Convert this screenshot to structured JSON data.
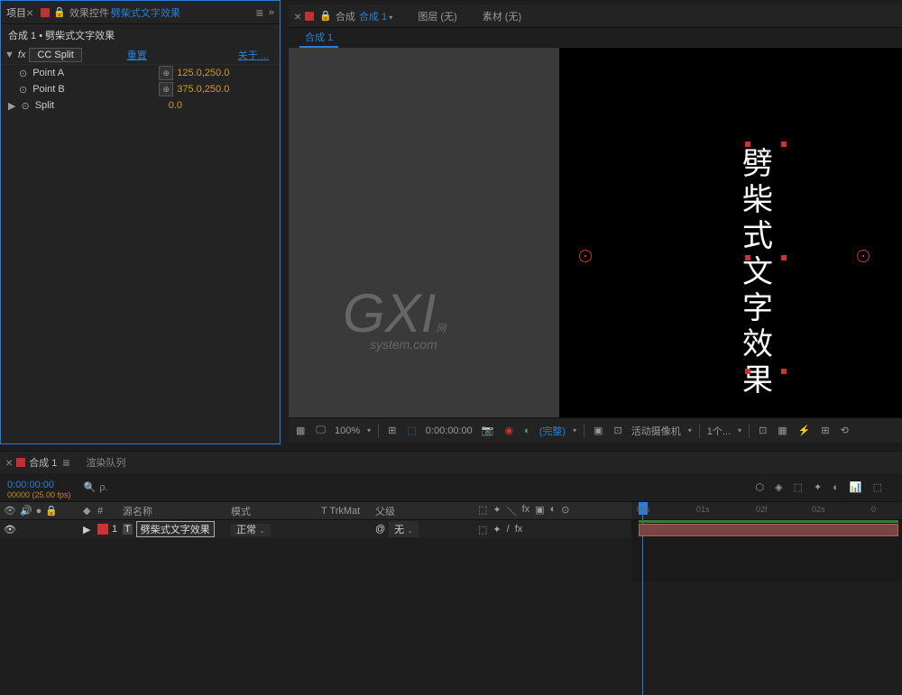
{
  "effects_panel": {
    "tab_label": "项目",
    "title_prefix": "效果控件",
    "title_link": "劈柴式文字效果",
    "hamburger": "≡",
    "breadcrumb": "合成 1 • 劈柴式文字效果",
    "fx_section": {
      "toggle": "▼",
      "fx_label": "fx",
      "name": "CC Split",
      "reset": "重置",
      "about": "关于 ..."
    },
    "props": [
      {
        "expand": "",
        "stopwatch": "⊙",
        "name": "Point A",
        "has_target": true,
        "value": "125.0,250.0"
      },
      {
        "expand": "",
        "stopwatch": "⊙",
        "name": "Point B",
        "has_target": true,
        "value": "375.0,250.0"
      },
      {
        "expand": "▶",
        "stopwatch": "⊙",
        "name": "Split",
        "has_target": false,
        "value": "0.0"
      }
    ]
  },
  "viewer": {
    "tabs": [
      {
        "prefix": "合成",
        "link": "合成 1"
      },
      {
        "prefix": "图层",
        "link": "(无)"
      },
      {
        "prefix": "素材",
        "link": "(无)"
      }
    ],
    "sub_tab": "合成 1",
    "watermark_main": "GXI",
    "watermark_suffix": "网",
    "watermark_sub": "system.com",
    "vertical_text": "劈柴式文字效果",
    "footer": {
      "zoom": "100%",
      "time": "0:00:00:00",
      "resolution": "(完整)",
      "camera": "活动摄像机",
      "views": "1个..."
    }
  },
  "timeline": {
    "tabs": [
      {
        "label": "合成 1",
        "active": true
      },
      {
        "label": "渲染队列",
        "active": false
      }
    ],
    "timecode": "0:00:00:00",
    "fps_label": "00000 (25.00 fps)",
    "search_placeholder": "ρ.",
    "headers": {
      "name": "源名称",
      "mode": "模式",
      "trkmat": "T  TrkMat",
      "parent": "父级"
    },
    "layers": [
      {
        "num": "1",
        "type": "T",
        "name": "劈柴式文字效果",
        "mode": "正常",
        "parent": "无"
      }
    ],
    "ruler_ticks": [
      "00s",
      "01s",
      "02f",
      "02s",
      "0"
    ]
  }
}
